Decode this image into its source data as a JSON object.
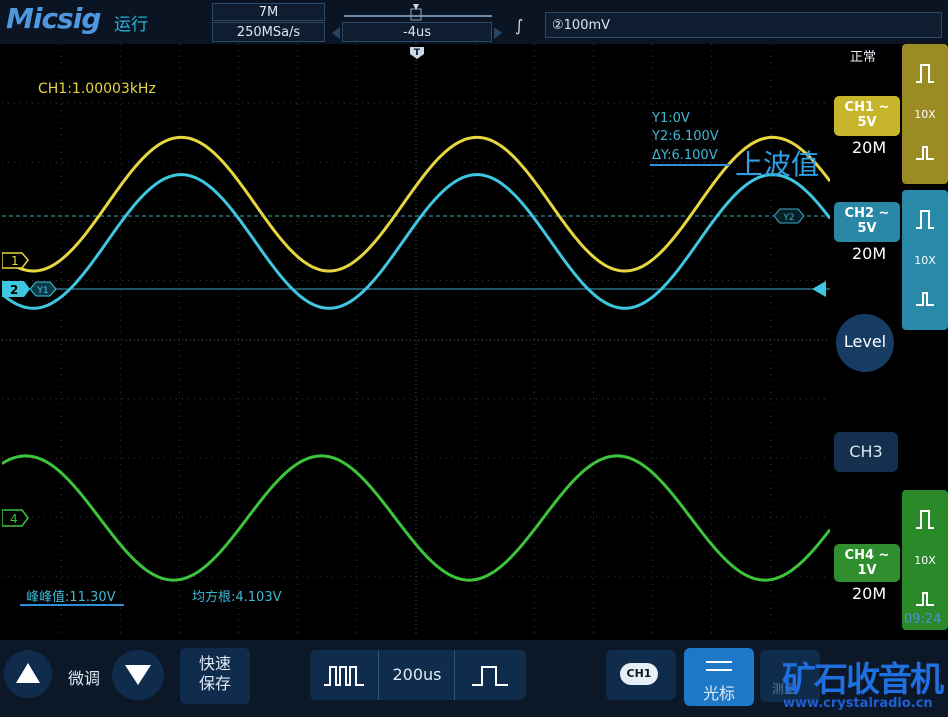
{
  "topbar": {
    "logo": "Micsig",
    "run_state": "运行",
    "memory_depth": "7M",
    "sample_rate": "250MSa/s",
    "time_position": "-4us",
    "trigger_mode_glyph": "∫",
    "trigger_level": "②100mV"
  },
  "status": {
    "mode": "正常",
    "time": "09:24"
  },
  "measurements": {
    "frequency": "CH1:1.00003kHz",
    "cursor_y1": "Y1:0V",
    "cursor_y2": "Y2:6.100V",
    "cursor_dy": "ΔY:6.100V",
    "annotation_upper": "上波值",
    "peak_to_peak": "峰峰值:11.30V",
    "rms": "均方根:4.103V"
  },
  "markers": {
    "ch1": "1",
    "ch2": "2",
    "ch4": "4",
    "y1": "Y1",
    "y2": "Y2",
    "trigger": "T"
  },
  "channels": {
    "ch1": {
      "label": "CH1 ~",
      "scale": "5V",
      "bandwidth": "20M",
      "probe": "10X",
      "color": "#e6d640"
    },
    "ch2": {
      "label": "CH2 ~",
      "scale": "5V",
      "bandwidth": "20M",
      "probe": "10X",
      "color": "#3fc6e0"
    },
    "ch3": {
      "label": "CH3"
    },
    "ch4": {
      "label": "CH4 ~",
      "scale": "1V",
      "bandwidth": "20M",
      "probe": "10X",
      "color": "#3cc43c"
    }
  },
  "level_button": "Level",
  "bottombar": {
    "fine_tune": "微调",
    "quick_save": "快速\n保存",
    "timebase": "200us",
    "ch_select": "CH1",
    "cursor": "光标",
    "watermark": "矿石收音机",
    "watermark_url": "www.crystalradio.cn",
    "hidden_label": "测量"
  },
  "chart_data": {
    "type": "line",
    "xlabel": "",
    "ylabel": "",
    "x_unit": "div",
    "xlim": [
      0,
      14
    ],
    "grid": true,
    "series": [
      {
        "name": "CH1",
        "color": "#e6d640",
        "scale_v_per_div": 5,
        "amplitude_v": 5.65,
        "offset_v": 1.0,
        "period_div": 5.0,
        "phase_peak_div": 3.03
      },
      {
        "name": "CH2",
        "color": "#3fc6e0",
        "scale_v_per_div": 5,
        "amplitude_v": 5.65,
        "offset_v": 0.3,
        "period_div": 5.0,
        "phase_peak_div": 3.03
      },
      {
        "name": "CH4",
        "color": "#3cc43c",
        "scale_v_per_div": 1,
        "amplitude_v": 1.05,
        "offset_v": 0.0,
        "period_div": 5.0,
        "phase_peak_div": 5.4
      }
    ]
  }
}
